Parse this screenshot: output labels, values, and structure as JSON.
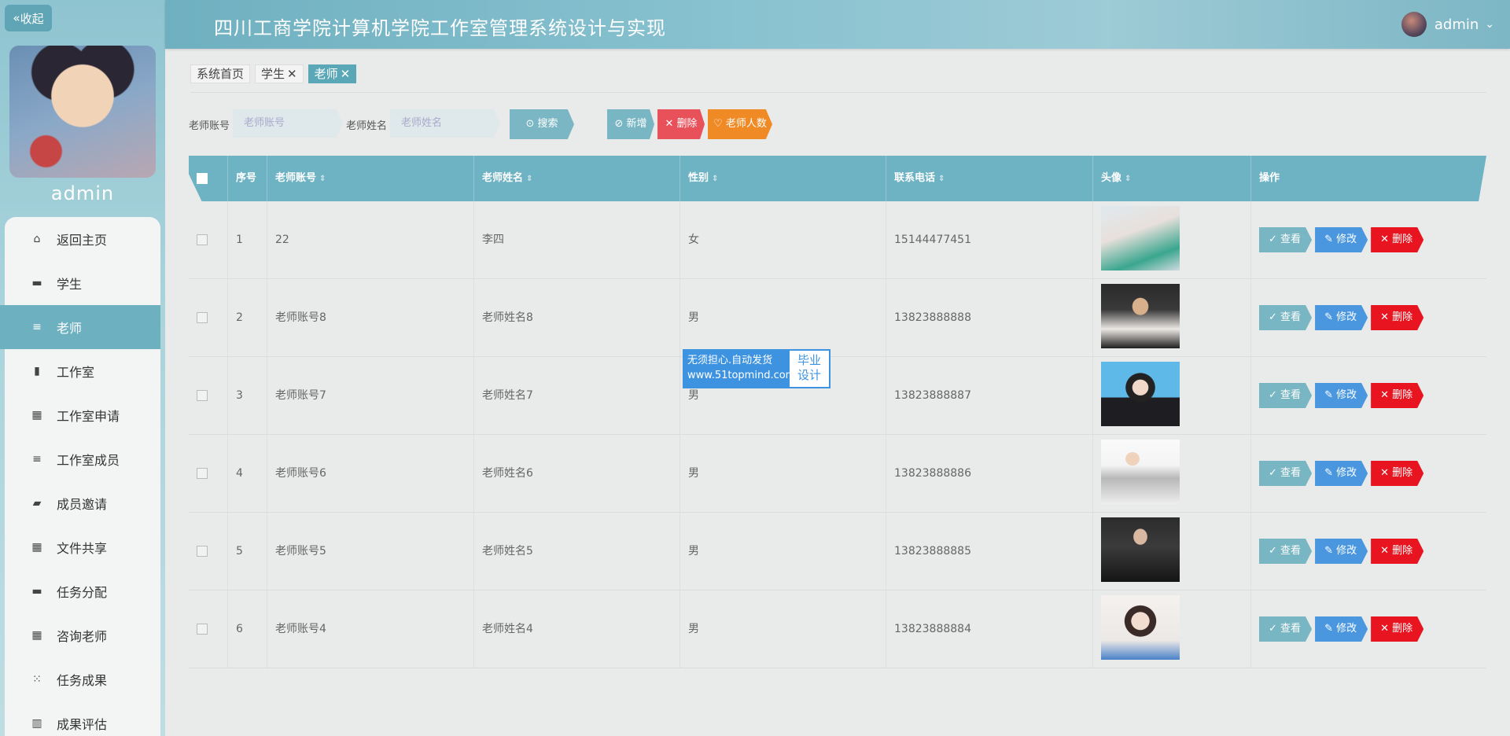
{
  "sidebar": {
    "collapse_label": "收起",
    "username": "admin",
    "items": [
      {
        "label": "返回主页",
        "icon": "home-icon"
      },
      {
        "label": "学生",
        "icon": "briefcase-icon"
      },
      {
        "label": "老师",
        "icon": "list-icon",
        "active": true
      },
      {
        "label": "工作室",
        "icon": "clipboard-icon"
      },
      {
        "label": "工作室申请",
        "icon": "grid-icon"
      },
      {
        "label": "工作室成员",
        "icon": "list-icon"
      },
      {
        "label": "成员邀请",
        "icon": "wallet-icon"
      },
      {
        "label": "文件共享",
        "icon": "grid-icon"
      },
      {
        "label": "任务分配",
        "icon": "monitor-icon"
      },
      {
        "label": "咨询老师",
        "icon": "grid-icon"
      },
      {
        "label": "任务成果",
        "icon": "apps-icon"
      },
      {
        "label": "成果评估",
        "icon": "bar-chart-icon"
      }
    ]
  },
  "header": {
    "title": "四川工商学院计算机学院工作室管理系统设计与实现",
    "user": "admin"
  },
  "tabs": [
    {
      "label": "系统首页",
      "closable": false
    },
    {
      "label": "学生",
      "closable": true
    },
    {
      "label": "老师",
      "closable": true,
      "active": true
    }
  ],
  "search": {
    "account_label": "老师账号",
    "account_placeholder": "老师账号",
    "name_label": "老师姓名",
    "name_placeholder": "老师姓名",
    "search_button": "搜索",
    "add_button": "新增",
    "delete_button": "删除",
    "count_button": "老师人数"
  },
  "table": {
    "columns": [
      "序号",
      "老师账号",
      "老师姓名",
      "性别",
      "联系电话",
      "头像",
      "操作"
    ],
    "actions": {
      "view": "查看",
      "edit": "修改",
      "delete": "删除"
    },
    "rows": [
      {
        "index": "1",
        "account": "22",
        "name": "李四",
        "gender": "女",
        "phone": "15144477451"
      },
      {
        "index": "2",
        "account": "老师账号8",
        "name": "老师姓名8",
        "gender": "男",
        "phone": "13823888888"
      },
      {
        "index": "3",
        "account": "老师账号7",
        "name": "老师姓名7",
        "gender": "男",
        "phone": "13823888887"
      },
      {
        "index": "4",
        "account": "老师账号6",
        "name": "老师姓名6",
        "gender": "男",
        "phone": "13823888886"
      },
      {
        "index": "5",
        "account": "老师账号5",
        "name": "老师姓名5",
        "gender": "男",
        "phone": "13823888885"
      },
      {
        "index": "6",
        "account": "老师账号4",
        "name": "老师姓名4",
        "gender": "男",
        "phone": "13823888884"
      }
    ]
  },
  "watermark": {
    "line1": "无须担心.自动发货",
    "line2": "www.51topmind.com",
    "right1": "毕业",
    "right2": "设计"
  },
  "colors": {
    "accent": "#6db0c0",
    "danger": "#e8141f",
    "primary": "#4a97e0",
    "warning": "#f08a24",
    "search_button": "#7bb6c4"
  }
}
